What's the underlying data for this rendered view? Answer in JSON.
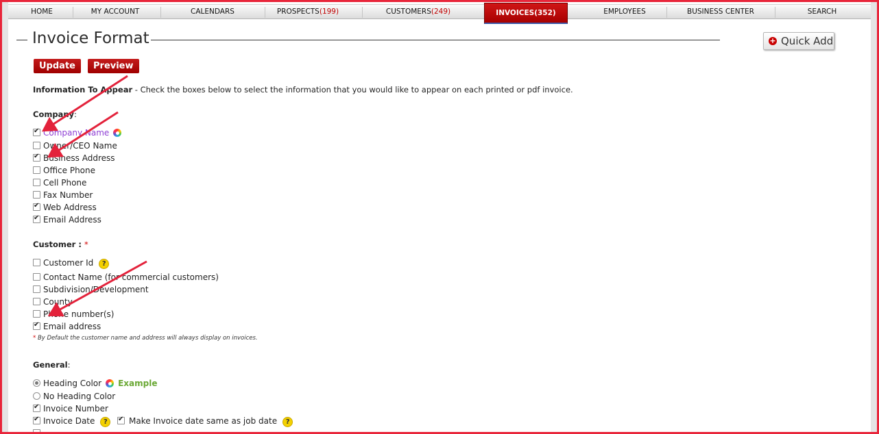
{
  "nav": {
    "items": [
      {
        "label": "HOME",
        "count": ""
      },
      {
        "label": "MY ACCOUNT",
        "count": ""
      },
      {
        "label": "CALENDARS",
        "count": ""
      },
      {
        "label": "PROSPECTS",
        "count": "(199)"
      },
      {
        "label": "CUSTOMERS",
        "count": "(249)"
      },
      {
        "label": "INVOICES",
        "count": "(352)"
      },
      {
        "label": "EMPLOYEES",
        "count": ""
      },
      {
        "label": "BUSINESS CENTER",
        "count": ""
      },
      {
        "label": "SEARCH",
        "count": ""
      }
    ],
    "active": "INVOICES"
  },
  "header": {
    "title": "Invoice Format",
    "quick_add_label": "Quick Add",
    "update_label": "Update",
    "preview_label": "Preview"
  },
  "info": {
    "bold": "Information To Appear",
    "text": " - Check the boxes below to select the information that you would like to appear on each printed or pdf invoice."
  },
  "company": {
    "title": "Company",
    "suffix": ":",
    "items": [
      {
        "label": "Company Name",
        "checked": true
      },
      {
        "label": "Owner/CEO Name",
        "checked": false
      },
      {
        "label": "Business Address",
        "checked": true
      },
      {
        "label": "Office Phone",
        "checked": false
      },
      {
        "label": "Cell Phone",
        "checked": false
      },
      {
        "label": "Fax Number",
        "checked": false
      },
      {
        "label": "Web Address",
        "checked": true
      },
      {
        "label": "Email Address",
        "checked": true
      }
    ]
  },
  "customer": {
    "title": "Customer :",
    "required_mark": "*",
    "items": [
      {
        "label": "Customer Id",
        "checked": false
      },
      {
        "label": "Contact Name (for commercial customers)",
        "checked": false
      },
      {
        "label": "Subdivision/Development",
        "checked": false
      },
      {
        "label": "County",
        "checked": false
      },
      {
        "label": "Phone number(s)",
        "checked": false
      },
      {
        "label": "Email address",
        "checked": true
      }
    ],
    "footnote_mark": "*",
    "footnote": " By Default the customer name and address will always display on invoices."
  },
  "general": {
    "title": "General",
    "suffix": ":",
    "heading_color_label": "Heading Color",
    "example_label": "Example",
    "no_heading_color_label": "No Heading Color",
    "invoice_number_label": "Invoice Number",
    "invoice_date_label": "Invoice Date",
    "same_as_job_date_label": "Make Invoice date same as job date"
  },
  "colors": {
    "frame": "#e8253a",
    "nav_active": "#c41c1c",
    "accent_red": "#c00000",
    "company_name_purple": "#8e3fd4",
    "example_green": "#6aa834"
  }
}
